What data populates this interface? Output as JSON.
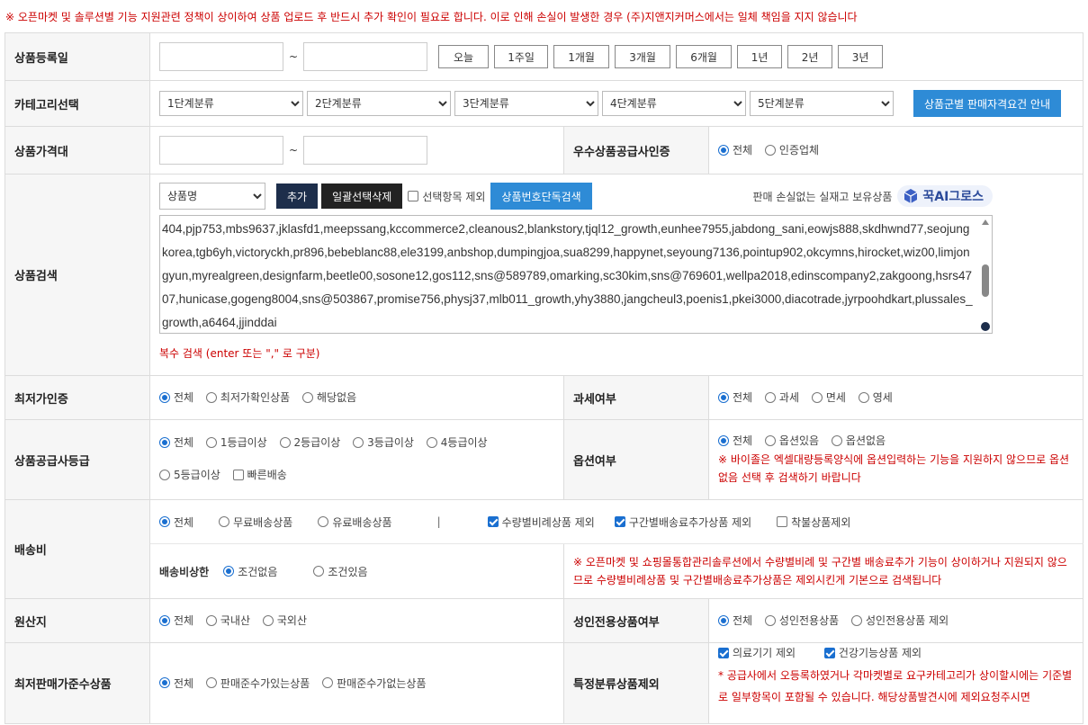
{
  "notice": "※ 오픈마켓 및 솔루션별 기능 지원관련 정책이 상이하여 상품 업로드 후 반드시 추가 확인이 필요로 합니다. 이로 인해 손실이 발생한 경우 (주)지앤지커머스에서는 일체 책임을 지지 않습니다",
  "reg_date": {
    "label": "상품등록일",
    "tilde": "~",
    "buttons": [
      "오늘",
      "1주일",
      "1개월",
      "3개월",
      "6개월",
      "1년",
      "2년",
      "3년"
    ]
  },
  "category": {
    "label": "카테고리선택",
    "selects": [
      "1단계분류",
      "2단계분류",
      "3단계분류",
      "4단계분류",
      "5단계분류"
    ],
    "guide_button": "상품군별 판매자격요건 안내"
  },
  "price": {
    "label": "상품가격대",
    "tilde": "~",
    "supplier_cert_label": "우수상품공급사인증",
    "supplier_cert_options": [
      "전체",
      "인증업체"
    ]
  },
  "search": {
    "label": "상품검색",
    "field_select": "상품명",
    "add_button": "추가",
    "bulk_delete_button": "일괄선택삭제",
    "exclude_label": "선택항목 제외",
    "single_search_button": "상품번호단독검색",
    "promo_text": "판매 손실없는 실재고 보유상품",
    "badge_text": "꾹AI그로스",
    "textarea_value": "404,pjp753,mbs9637,jklasfd1,meepssang,kccommerce2,cleanous2,blankstory,tjql12_growth,eunhee7955,jabdong_sani,eowjs888,skdhwnd77,seojungkorea,tgb6yh,victoryckh,pr896,bebeblanc88,ele3199,anbshop,dumpingjoa,sua8299,happynet,seyoung7136,pointup902,okcymns,hirocket,wiz00,limjongyun,myrealgreen,designfarm,beetle00,sosone12,gos112,sns@589789,omarking,sc30kim,sns@769601,wellpa2018,edinscompany2,zakgoong,hsrs4707,hunicase,gogeng8004,sns@503867,promise756,physj37,mlb011_growth,yhy3880,jangcheul3,poenis1,pkei3000,diacotrade,jyrpoohdkart,plussales_growth,a6464,jjinddai",
    "hint": "복수 검색 (enter 또는 \",\" 로 구분)"
  },
  "lowest_price": {
    "label": "최저가인증",
    "options": [
      "전체",
      "최저가확인상품",
      "해당없음"
    ],
    "tax_label": "과세여부",
    "tax_options": [
      "전체",
      "과세",
      "면세",
      "영세"
    ]
  },
  "supplier_grade": {
    "label": "상품공급사등급",
    "options": [
      "전체",
      "1등급이상",
      "2등급이상",
      "3등급이상",
      "4등급이상",
      "5등급이상"
    ],
    "fast_delivery": "빠른배송",
    "option_label": "옵션여부",
    "option_options": [
      "전체",
      "옵션있음",
      "옵션없음"
    ],
    "option_note": "※ 바이졸은 엑셀대량등록양식에 옵션입력하는 기능을 지원하지 않으므로 옵션없음 선택 후 검색하기 바랍니다"
  },
  "shipping": {
    "label": "배송비",
    "options": [
      "전체",
      "무료배송상품",
      "유료배송상품"
    ],
    "divider": "|",
    "checks": [
      {
        "label": "수량별비례상품 제외",
        "checked": true
      },
      {
        "label": "구간별배송료추가상품 제외",
        "checked": true
      },
      {
        "label": "착불상품제외",
        "checked": false
      }
    ],
    "limit_label": "배송비상한",
    "limit_options": [
      "조건없음",
      "조건있음"
    ],
    "note": "※ 오픈마켓 및 쇼핑몰통합관리솔루션에서 수량별비례 및 구간별 배송료추가 기능이 상이하거나 지원되지 않으므로 수량별비례상품 및 구간별배송료추가상품은 제외시킨게 기본으로 검색됩니다"
  },
  "origin": {
    "label": "원산지",
    "options": [
      "전체",
      "국내산",
      "국외산"
    ],
    "adult_label": "성인전용상품여부",
    "adult_options": [
      "전체",
      "성인전용상품",
      "성인전용상품 제외"
    ]
  },
  "min_price": {
    "label": "최저판매가준수상품",
    "options": [
      "전체",
      "판매준수가있는상품",
      "판매준수가없는상품"
    ],
    "special_label": "특정분류상품제외",
    "special_checks": [
      {
        "label": "의료기기 제외",
        "checked": true
      },
      {
        "label": "건강기능상품 제외",
        "checked": true
      }
    ],
    "special_note": "* 공급사에서 오등록하였거나 각마켓별로 요구카테고리가 상이할시에는 기준별로 일부항목이 포함될 수 있습니다. 해당상품발견시에 제외요청주시면"
  },
  "colors": {
    "accent": "#2e8bd6",
    "navy": "#1d2e4b",
    "warning": "#cc0000"
  }
}
